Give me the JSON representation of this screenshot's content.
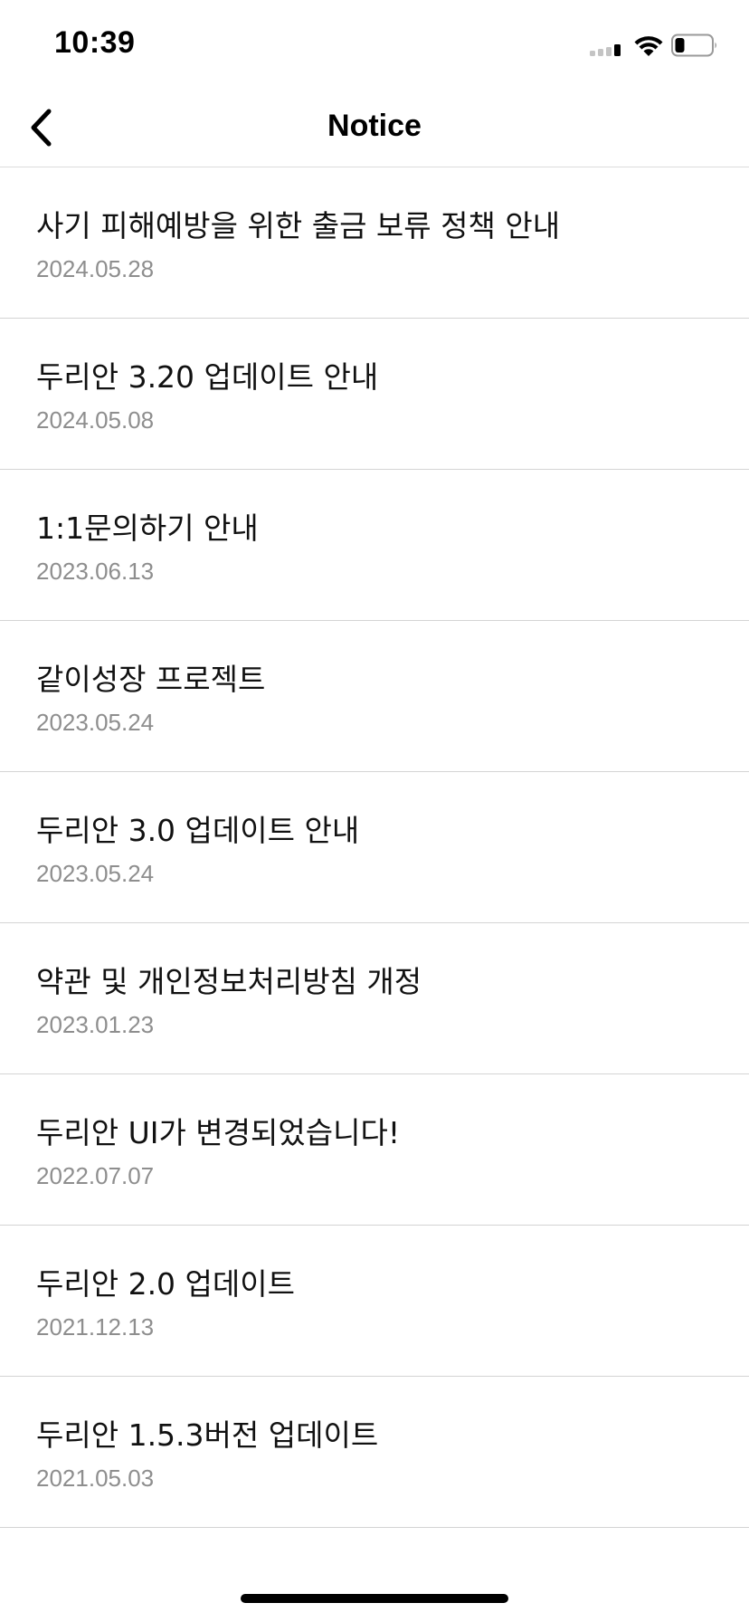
{
  "status_bar": {
    "time": "10:39",
    "signal_icon": "cellular-signal-icon",
    "wifi_icon": "wifi-icon",
    "battery_icon": "battery-icon",
    "battery_level": 0.25
  },
  "nav": {
    "back_icon": "chevron-left-icon",
    "title": "Notice"
  },
  "notices": [
    {
      "title": "사기 피해예방을 위한 출금 보류 정책 안내",
      "date": "2024.05.28"
    },
    {
      "title": "두리안 3.20 업데이트 안내",
      "date": "2024.05.08"
    },
    {
      "title": "1:1문의하기 안내",
      "date": "2023.06.13"
    },
    {
      "title": "같이성장 프로젝트",
      "date": "2023.05.24"
    },
    {
      "title": "두리안 3.0 업데이트 안내",
      "date": "2023.05.24"
    },
    {
      "title": "약관 및 개인정보처리방침 개정",
      "date": "2023.01.23"
    },
    {
      "title": "두리안 UI가 변경되었습니다!",
      "date": "2022.07.07"
    },
    {
      "title": "두리안 2.0 업데이트",
      "date": "2021.12.13"
    },
    {
      "title": "두리안 1.5.3버전 업데이트",
      "date": "2021.05.03"
    }
  ],
  "colors": {
    "title_text": "#111111",
    "date_text": "#8e8e8e",
    "divider": "#d4d4d4",
    "background": "#ffffff"
  }
}
